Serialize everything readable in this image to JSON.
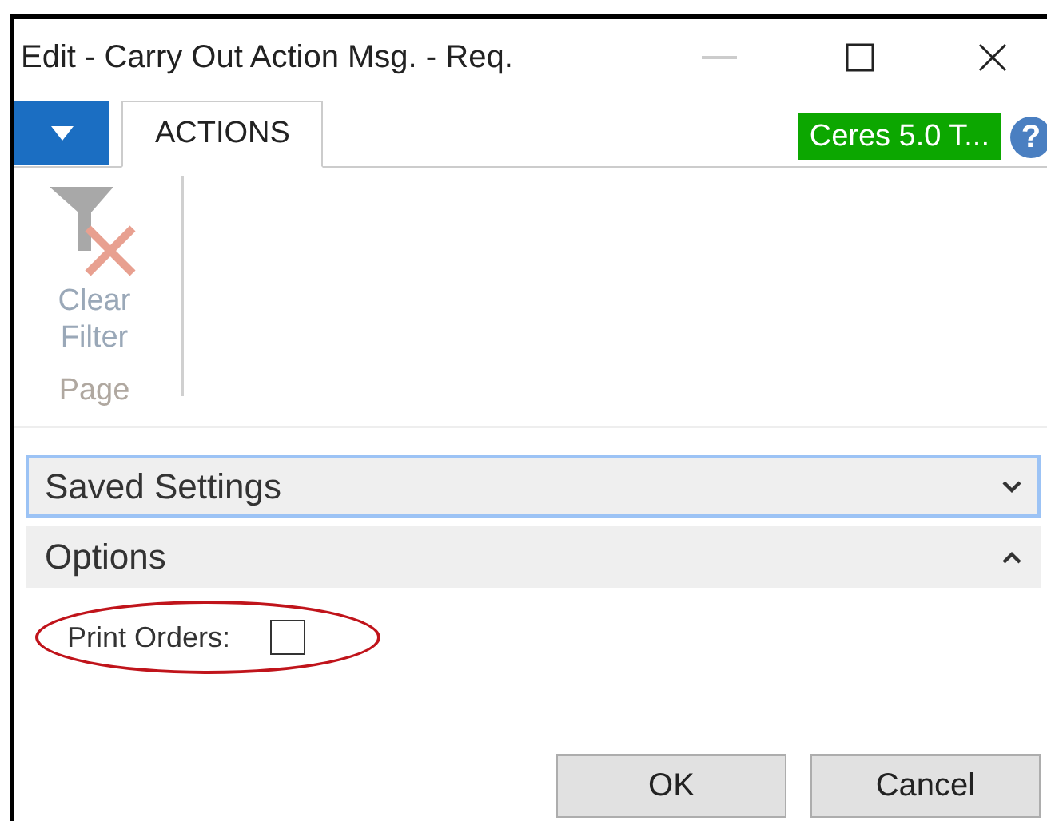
{
  "window": {
    "title": "Edit - Carry Out Action Msg. - Req."
  },
  "tabs": [
    {
      "label": "ACTIONS",
      "selected": true
    }
  ],
  "company_badge": "Ceres 5.0 T...",
  "help_button": "?",
  "ribbon": {
    "actions": [
      {
        "label": "Clear Filter",
        "disabled": true
      }
    ],
    "group": "Page"
  },
  "sections": [
    {
      "title": "Saved Settings",
      "expanded": false,
      "focused": true
    },
    {
      "title": "Options",
      "expanded": true,
      "focused": false
    }
  ],
  "fields": [
    {
      "label": "Print Orders:",
      "checked": false,
      "highlighted": true
    }
  ],
  "buttons": [
    "OK",
    "Cancel"
  ]
}
